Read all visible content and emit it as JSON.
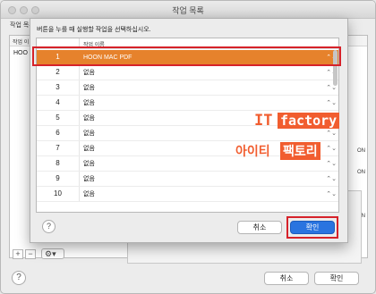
{
  "window": {
    "title": "작업 목록"
  },
  "background": {
    "label": "작업 목록",
    "column_header": "작업 이",
    "first_cell": "HOO",
    "right_texts": [
      "ON",
      "ON",
      "ON"
    ],
    "plus_label": "+",
    "minus_label": "−",
    "gear_label": "⚙▾",
    "cancel_label": "취소",
    "ok_label": "확인",
    "help_label": "?"
  },
  "sheet": {
    "instruction": "버튼을 누를 때 실행할 작업을 선택하십시오.",
    "column_name": "작업 이름",
    "rows": [
      {
        "num": "1",
        "value": "HOON MAC PDF",
        "selected": true
      },
      {
        "num": "2",
        "value": "없음"
      },
      {
        "num": "3",
        "value": "없음"
      },
      {
        "num": "4",
        "value": "없음"
      },
      {
        "num": "5",
        "value": "없음"
      },
      {
        "num": "6",
        "value": "없음"
      },
      {
        "num": "7",
        "value": "없음"
      },
      {
        "num": "8",
        "value": "없음"
      },
      {
        "num": "9",
        "value": "없음"
      },
      {
        "num": "10",
        "value": "없음"
      }
    ],
    "stepper_glyph": "⌃⌄",
    "help_label": "?",
    "cancel_label": "취소",
    "ok_label": "확인"
  },
  "watermark": {
    "it": "IT",
    "factory": "factory",
    "korean_a": "아이티",
    "korean_b": "팩토리"
  },
  "colors": {
    "selection": "#e6822c",
    "highlight": "#d6222a",
    "primary_button": "#2a74e0",
    "watermark": "#f15d2f"
  }
}
